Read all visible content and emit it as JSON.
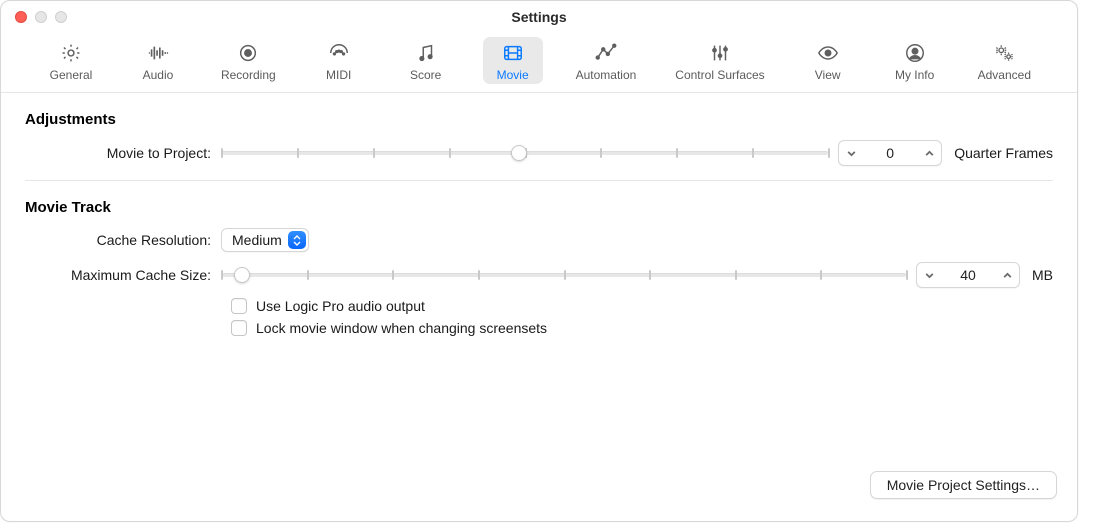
{
  "window": {
    "title": "Settings"
  },
  "toolbar": {
    "items": [
      {
        "id": "general",
        "label": "General",
        "selected": false
      },
      {
        "id": "audio",
        "label": "Audio",
        "selected": false
      },
      {
        "id": "recording",
        "label": "Recording",
        "selected": false
      },
      {
        "id": "midi",
        "label": "MIDI",
        "selected": false
      },
      {
        "id": "score",
        "label": "Score",
        "selected": false
      },
      {
        "id": "movie",
        "label": "Movie",
        "selected": true
      },
      {
        "id": "automation",
        "label": "Automation",
        "selected": false
      },
      {
        "id": "control-surfaces",
        "label": "Control Surfaces",
        "selected": false
      },
      {
        "id": "view",
        "label": "View",
        "selected": false
      },
      {
        "id": "my-info",
        "label": "My Info",
        "selected": false
      },
      {
        "id": "advanced",
        "label": "Advanced",
        "selected": false
      }
    ]
  },
  "adjustments": {
    "header": "Adjustments",
    "movie_to_project_label": "Movie to Project:",
    "movie_to_project_value": "0",
    "movie_to_project_unit": "Quarter Frames",
    "movie_to_project_pos_pct": 49
  },
  "movie_track": {
    "header": "Movie Track",
    "cache_resolution_label": "Cache Resolution:",
    "cache_resolution_value": "Medium",
    "max_cache_label": "Maximum Cache Size:",
    "max_cache_value": "40",
    "max_cache_unit": "MB",
    "max_cache_pos_pct": 3,
    "use_logic_audio_label": "Use Logic Pro audio output",
    "use_logic_audio_checked": false,
    "lock_movie_window_label": "Lock movie window when changing screensets",
    "lock_movie_window_checked": false
  },
  "footer": {
    "project_settings_label": "Movie Project Settings…"
  }
}
